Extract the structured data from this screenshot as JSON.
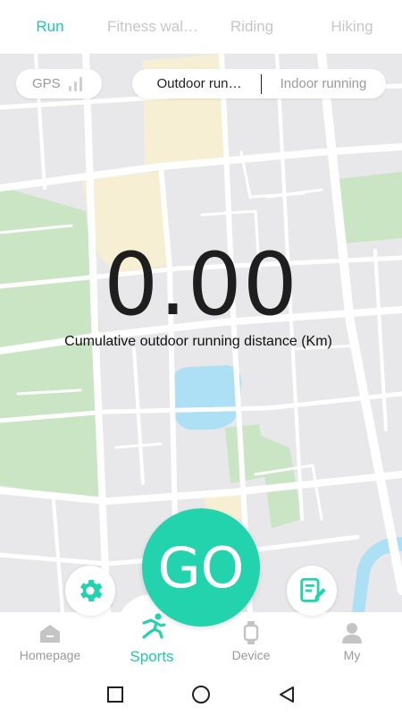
{
  "tabs": [
    {
      "label": "Run",
      "active": true
    },
    {
      "label": "Fitness wal…",
      "active": false
    },
    {
      "label": "Riding",
      "active": false
    },
    {
      "label": "Hiking",
      "active": false
    }
  ],
  "gps": {
    "label": "GPS",
    "signal_bars": 0
  },
  "mode": {
    "outdoor": "Outdoor run…",
    "indoor": "Indoor running",
    "selected": "outdoor"
  },
  "distance": {
    "value": "0.00",
    "label": "Cumulative outdoor running distance (Km)"
  },
  "go_button": {
    "label": "GO"
  },
  "bottom_nav": [
    {
      "label": "Homepage",
      "icon": "home-icon",
      "active": false
    },
    {
      "label": "Sports",
      "icon": "running-person-icon",
      "active": true
    },
    {
      "label": "Device",
      "icon": "watch-icon",
      "active": false
    },
    {
      "label": "My",
      "icon": "user-icon",
      "active": false
    }
  ],
  "colors": {
    "accent": "#22d3ae",
    "accent_text": "#1fc8a9",
    "map_bg": "#e8e8ea",
    "park": "#c9e5c3",
    "water": "#aee0f5",
    "building": "#f7efd3"
  }
}
